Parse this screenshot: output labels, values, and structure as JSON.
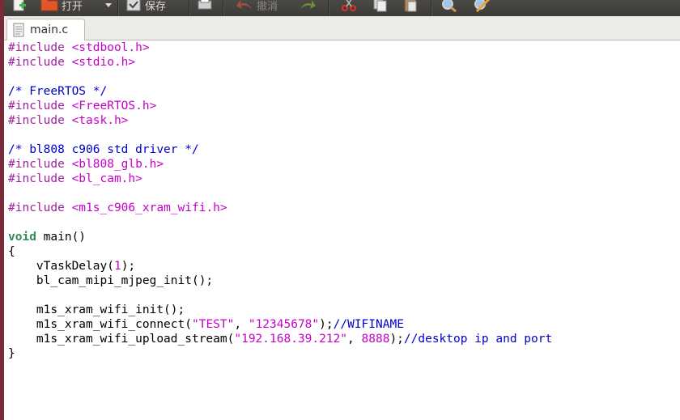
{
  "toolbar": {
    "open_label": "打开",
    "save_label": "保存",
    "undo_label": "撤消"
  },
  "tab": {
    "filename": "main.c"
  },
  "code": {
    "l1a": "#include",
    "l1b": "<stdbool.h>",
    "l2a": "#include",
    "l2b": "<stdio.h>",
    "l4": "/* FreeRTOS */",
    "l5a": "#include",
    "l5b": "<FreeRTOS.h>",
    "l6a": "#include",
    "l6b": "<task.h>",
    "l8": "/* bl808 c906 std driver */",
    "l9a": "#include",
    "l9b": "<bl808_glb.h>",
    "l10a": "#include",
    "l10b": "<bl_cam.h>",
    "l12a": "#include",
    "l12b": "<m1s_c906_xram_wifi.h>",
    "l14kw": "void",
    "l14rest": "main()",
    "l15": "{",
    "l16a": "    vTaskDelay(",
    "l16n": "1",
    "l16b": ");",
    "l17": "    bl_cam_mipi_mjpeg_init();",
    "l19": "    m1s_xram_wifi_init();",
    "l20a": "    m1s_xram_wifi_connect(",
    "l20s1": "\"TEST\"",
    "l20c": ", ",
    "l20s2": "\"12345678\"",
    "l20e": ");",
    "l20cm": "//WIFINAME",
    "l21a": "    m1s_xram_wifi_upload_stream(",
    "l21s": "\"192.168.39.212\"",
    "l21c": ", ",
    "l21n": "8888",
    "l21e": ");",
    "l21cm": "//desktop ip and port",
    "l22": "}"
  },
  "colors": {
    "preprocessor": "#a020a0",
    "include_path": "#c800c8",
    "comment": "#0000cc",
    "keyword": "#2e8b57",
    "toolbar_bg": "#3c3b37"
  }
}
